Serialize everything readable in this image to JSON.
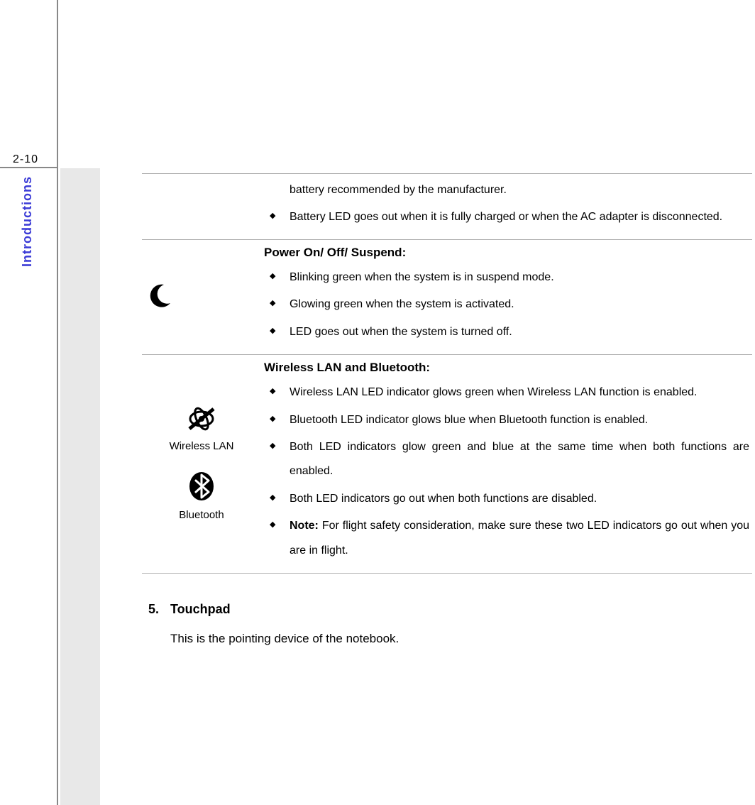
{
  "page_number": "2-10",
  "side_tab": "Introductions",
  "rows": {
    "battery": {
      "lines": [
        "battery recommended by the manufacturer."
      ],
      "bullets": [
        "Battery LED goes out when it is fully charged or when the AC adapter is disconnected."
      ]
    },
    "power": {
      "title": "Power On/ Off/ Suspend:",
      "bullets": [
        "Blinking green when the system is in suspend mode.",
        "Glowing green when the system is activated.",
        "LED goes out when the system is turned off."
      ]
    },
    "wlan_bt": {
      "title": "Wireless LAN and Bluetooth:",
      "icon_captions": {
        "wlan": "Wireless LAN",
        "bt": "Bluetooth"
      },
      "bullets": [
        "Wireless LAN LED indicator glows green when Wireless LAN function is enabled.",
        "Bluetooth LED indicator glows blue when Bluetooth function is enabled.",
        "Both LED indicators glow green and blue at the same time when both functions are enabled.",
        "Both LED indicators go out when both functions are disabled."
      ],
      "note_label": "Note:",
      "note_text": " For flight safety consideration, make sure these two LED indicators go out when you are in flight."
    }
  },
  "section5": {
    "number": "5.",
    "title": "Touchpad",
    "body": "This is the pointing device of the notebook."
  }
}
